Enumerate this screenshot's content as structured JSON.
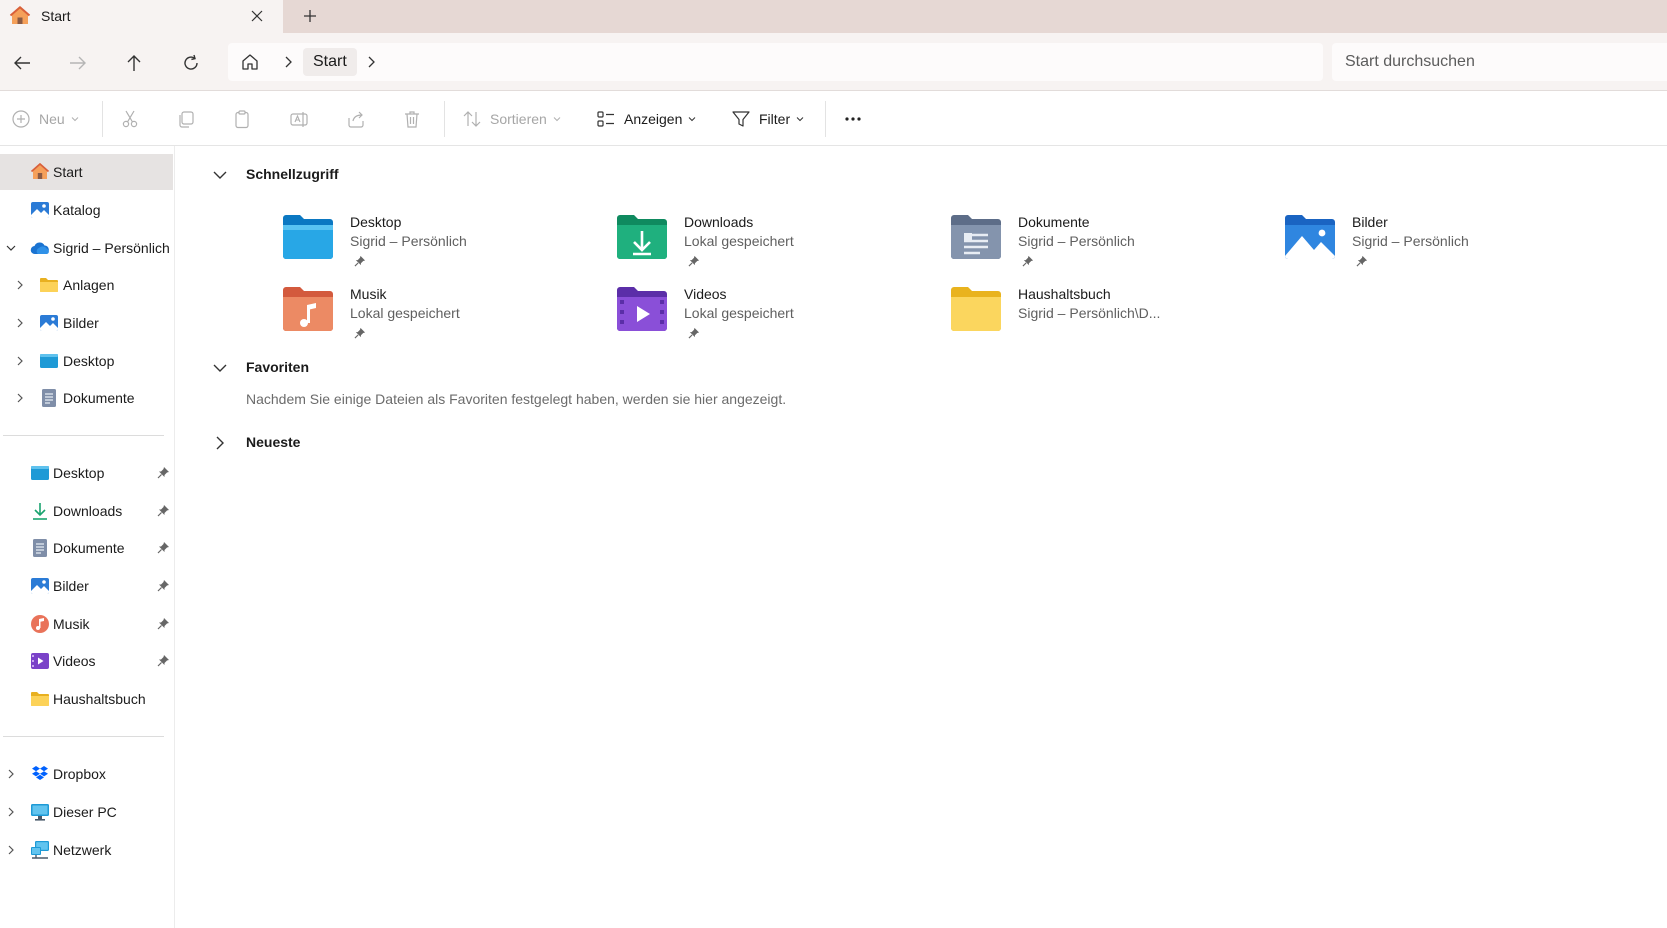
{
  "window": {
    "tab_title": "Start",
    "tab_icon": "home-icon",
    "new_tab_label": "+"
  },
  "address": {
    "breadcrumb": [
      "Start"
    ],
    "search_placeholder": "Start durchsuchen"
  },
  "commands": {
    "new_label": "Neu",
    "sort_label": "Sortieren",
    "view_label": "Anzeigen",
    "filter_label": "Filter",
    "more_label": "..."
  },
  "sidebar": {
    "top_items": [
      {
        "label": "Start",
        "icon": "home-icon",
        "selected": true
      },
      {
        "label": "Katalog",
        "icon": "gallery-icon"
      },
      {
        "label": "Sigrid – Persönlich",
        "icon": "onedrive-icon",
        "expanded": true
      },
      {
        "label": "Anlagen",
        "icon": "folder-icon"
      },
      {
        "label": "Bilder",
        "icon": "pictures-icon"
      },
      {
        "label": "Desktop",
        "icon": "desktop-icon"
      },
      {
        "label": "Dokumente",
        "icon": "documents-icon"
      }
    ],
    "pinned_items": [
      {
        "label": "Desktop",
        "icon": "desktop-icon",
        "pinned": true
      },
      {
        "label": "Downloads",
        "icon": "downloads-icon",
        "pinned": true
      },
      {
        "label": "Dokumente",
        "icon": "documents-icon",
        "pinned": true
      },
      {
        "label": "Bilder",
        "icon": "pictures-icon",
        "pinned": true
      },
      {
        "label": "Musik",
        "icon": "music-icon",
        "pinned": true
      },
      {
        "label": "Videos",
        "icon": "videos-icon",
        "pinned": true
      },
      {
        "label": "Haushaltsbuch",
        "icon": "folder-icon",
        "pinned": false
      }
    ],
    "bottom_items": [
      {
        "label": "Dropbox",
        "icon": "dropbox-icon"
      },
      {
        "label": "Dieser PC",
        "icon": "pc-icon"
      },
      {
        "label": "Netzwerk",
        "icon": "network-icon"
      }
    ]
  },
  "main": {
    "quick_access": {
      "title": "Schnellzugriff",
      "items": [
        {
          "name": "Desktop",
          "sub": "Sigrid – Persönlich",
          "icon": "desktop-folder-icon",
          "pinned": true
        },
        {
          "name": "Downloads",
          "sub": "Lokal gespeichert",
          "icon": "downloads-folder-icon",
          "pinned": true
        },
        {
          "name": "Dokumente",
          "sub": "Sigrid – Persönlich",
          "icon": "documents-folder-icon",
          "pinned": true
        },
        {
          "name": "Bilder",
          "sub": "Sigrid – Persönlich",
          "icon": "pictures-folder-icon",
          "pinned": true
        },
        {
          "name": "Musik",
          "sub": "Lokal gespeichert",
          "icon": "music-folder-icon",
          "pinned": true
        },
        {
          "name": "Videos",
          "sub": "Lokal gespeichert",
          "icon": "videos-folder-icon",
          "pinned": true
        },
        {
          "name": "Haushaltsbuch",
          "sub": "Sigrid – Persönlich\\D...",
          "icon": "folder-icon",
          "pinned": false
        }
      ]
    },
    "favorites": {
      "title": "Favoriten",
      "empty_text": "Nachdem Sie einige Dateien als Favoriten festgelegt haben, werden sie hier angezeigt."
    },
    "recent": {
      "title": "Neueste"
    }
  },
  "colors": {
    "tabstrip": "#e6d8d4",
    "chrome": "#f7f3f2",
    "selected": "#e6e3e2",
    "accent": "#0067c0"
  }
}
